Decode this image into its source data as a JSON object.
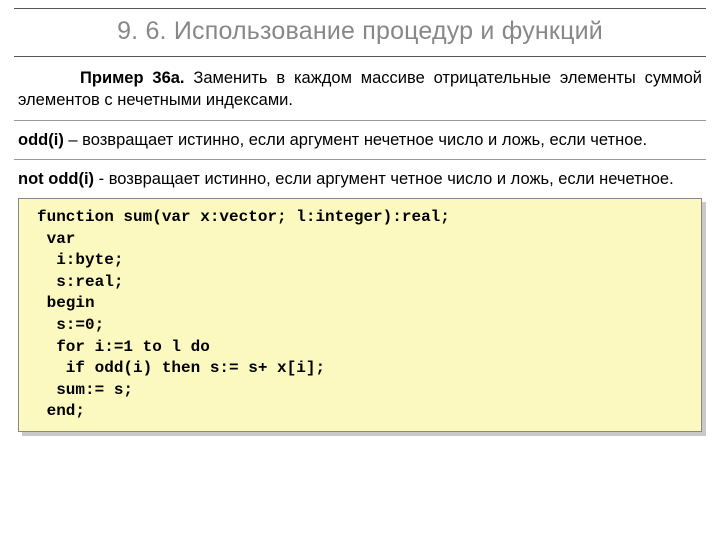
{
  "title": "9. 6. Использование процедур и функций",
  "example": {
    "label": "Пример 36а.",
    "text": "Заменить в каждом массиве отрицательные элементы суммой элементов с нечетными индексами."
  },
  "notes": [
    {
      "term": "odd(i)",
      "sep": " – ",
      "desc": "возвращает истинно, если аргумент нечетное число и ложь, если четное."
    },
    {
      "term": "not odd(i)",
      "sep": " - ",
      "desc": "возвращает истинно, если аргумент четное число и ложь, если нечетное."
    }
  ],
  "code_lines": [
    "function sum(var x:vector; l:integer):real;",
    " var",
    "  i:byte;",
    "  s:real;",
    " begin",
    "  s:=0;",
    "  for i:=1 to l do",
    "   if odd(i) then s:= s+ x[i];",
    "  sum:= s;",
    " end;"
  ]
}
